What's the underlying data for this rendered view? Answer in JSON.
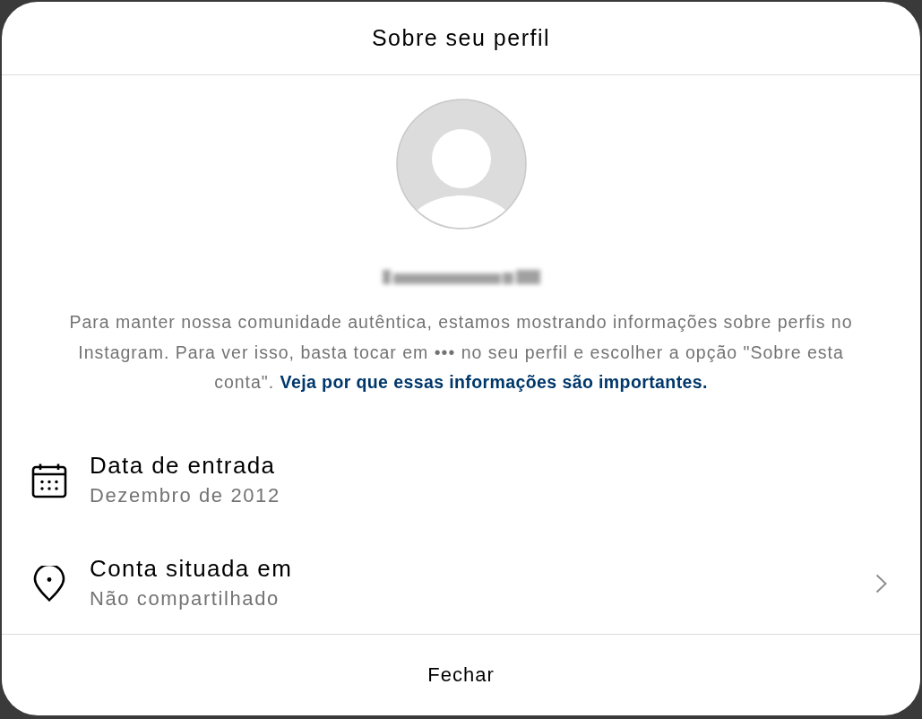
{
  "dialog": {
    "title": "Sobre seu perfil"
  },
  "notice": {
    "text": "Para manter nossa comunidade autêntica, estamos mostrando informações sobre perfis no Instagram. Para ver isso, basta tocar em ••• no seu perfil e escolher a opção \"Sobre esta conta\".",
    "link": "Veja por que essas informações são importantes."
  },
  "details": [
    {
      "kind": "date",
      "label": "Data de entrada",
      "value": "Dezembro de 2012",
      "chevron": false
    },
    {
      "kind": "location",
      "label": "Conta situada em",
      "value": "Não compartilhado",
      "chevron": true
    }
  ],
  "close_button": "Fechar"
}
